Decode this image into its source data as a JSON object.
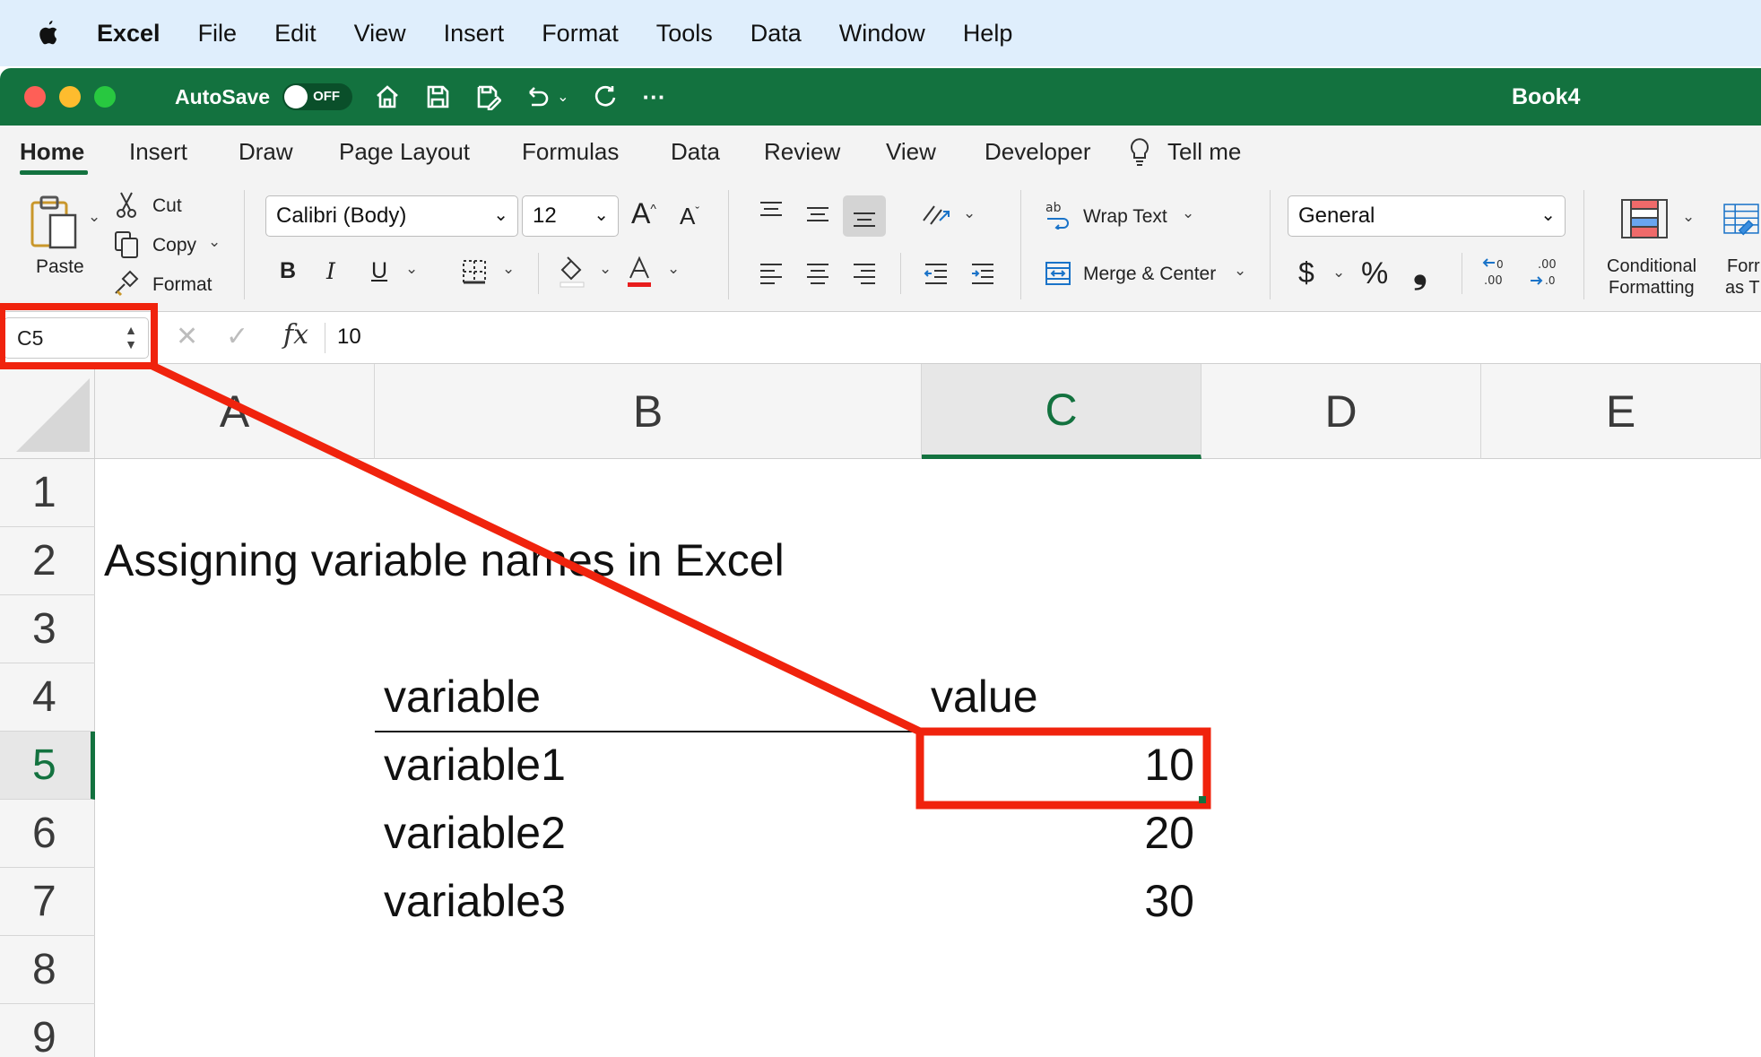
{
  "menubar": {
    "app": "Excel",
    "items": [
      "File",
      "Edit",
      "View",
      "Insert",
      "Format",
      "Tools",
      "Data",
      "Window",
      "Help"
    ]
  },
  "titlebar": {
    "autosave_label": "AutoSave",
    "autosave_state": "OFF",
    "document_title": "Book4"
  },
  "ribbon_tabs": [
    "Home",
    "Insert",
    "Draw",
    "Page Layout",
    "Formulas",
    "Data",
    "Review",
    "View",
    "Developer",
    "Tell me"
  ],
  "ribbon": {
    "paste": "Paste",
    "cut": "Cut",
    "copy": "Copy",
    "format": "Format",
    "font_name": "Calibri (Body)",
    "font_size": "12",
    "bold": "B",
    "italic": "I",
    "underline": "U",
    "wrap_text": "Wrap Text",
    "merge_center": "Merge & Center",
    "number_format": "General",
    "currency": "$",
    "percent": "%",
    "comma": "❟",
    "conditional_formatting_line1": "Conditional",
    "conditional_formatting_line2": "Formatting",
    "format_as_table_line1": "Forr",
    "format_as_table_line2": "as T"
  },
  "formula_bar": {
    "name_box": "C5",
    "fx": "fx",
    "content": "10"
  },
  "columns": [
    "A",
    "B",
    "C",
    "D",
    "E"
  ],
  "rows": [
    "1",
    "2",
    "3",
    "4",
    "5",
    "6",
    "7",
    "8",
    "9"
  ],
  "sheet": {
    "title": "Assigning variable names in Excel",
    "header_variable": "variable",
    "header_value": "value",
    "data": [
      {
        "name": "variable1",
        "value": "10"
      },
      {
        "name": "variable2",
        "value": "20"
      },
      {
        "name": "variable3",
        "value": "30"
      }
    ]
  },
  "colors": {
    "title_bar": "#13723f",
    "menu_bar": "#dfeefc",
    "annotation": "#f0230d"
  }
}
